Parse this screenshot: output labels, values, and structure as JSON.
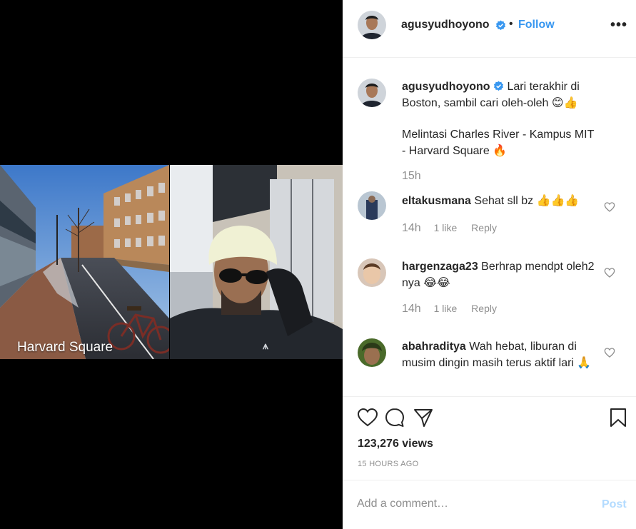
{
  "video": {
    "caption": "Harvard Square"
  },
  "header": {
    "username": "agusyudhoyono",
    "separator": "•",
    "follow_label": "Follow",
    "more_label": "•••"
  },
  "caption": {
    "username": "agusyudhoyono",
    "line1": "Lari terakhir di Boston, sambil cari oleh-oleh",
    "emoji1": "😊👍",
    "line2": "Melintasi Charles River - Kampus MIT - Harvard Square",
    "emoji2": "🔥",
    "time": "15h"
  },
  "comments": [
    {
      "username": "eltakusmana",
      "text": "Sehat sll bz",
      "emoji": "👍👍👍",
      "time": "14h",
      "likes": "1 like",
      "reply": "Reply"
    },
    {
      "username": "hargenzaga23",
      "text": "Berhrap mendpt oleh2 nya",
      "emoji": "😂😂",
      "time": "14h",
      "likes": "1 like",
      "reply": "Reply"
    },
    {
      "username": "abahraditya",
      "text": "Wah hebat, liburan di musim dingin masih terus aktif lari",
      "emoji": "🙏"
    }
  ],
  "stats": {
    "views": "123,276 views",
    "posted": "15 HOURS AGO"
  },
  "comment_box": {
    "placeholder": "Add a comment…",
    "post_label": "Post"
  },
  "colors": {
    "accent": "#3897f0",
    "post_disabled": "#b3dbff",
    "meta": "#8e8e8e",
    "text": "#262626"
  }
}
